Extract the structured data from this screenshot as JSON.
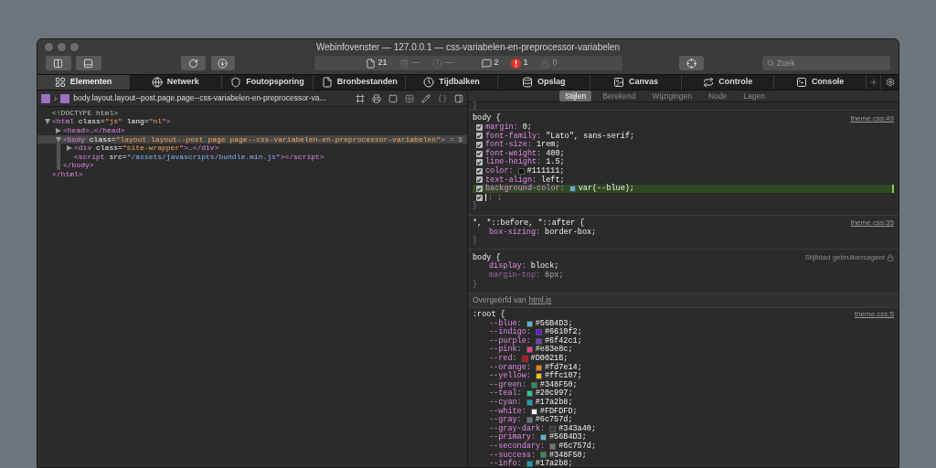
{
  "window": {
    "title": "Webinfovenster — 127.0.0.1 — css-variabelen-en-preprocessor-variabelen"
  },
  "toolbar": {
    "status_items": [
      {
        "text": "21",
        "disabled": false
      },
      {
        "text": "—",
        "disabled": true
      },
      {
        "text": "—",
        "disabled": true
      },
      {
        "text": "2",
        "disabled": false
      },
      {
        "text": "1",
        "disabled": false
      },
      {
        "text": "0",
        "disabled": true
      }
    ],
    "search": {
      "placeholder": "Zoek"
    }
  },
  "tabs": [
    {
      "label": "Elementen",
      "selected": true
    },
    {
      "label": "Netwerk",
      "selected": false
    },
    {
      "label": "Foutopsporing",
      "selected": false
    },
    {
      "label": "Bronbestanden",
      "selected": false
    },
    {
      "label": "Tijdbalken",
      "selected": false
    },
    {
      "label": "Opslag",
      "selected": false
    },
    {
      "label": "Canvas",
      "selected": false
    },
    {
      "label": "Controle",
      "selected": false
    },
    {
      "label": "Console",
      "selected": false
    }
  ],
  "breadcrumb": {
    "separator": "›",
    "path": "body.layout.layout--post.page.page--css-variabelen-en-preprocessor-va..."
  },
  "dom_tree": [
    {
      "kind": "doctype",
      "text": "<!DOCTYPE html>"
    },
    {
      "kind": "element",
      "expanded": true,
      "selected": false,
      "parts": [
        {
          "kind": "tag",
          "text": "<html"
        },
        {
          "kind": "attr",
          "text": " class="
        },
        {
          "kind": "value",
          "text": "\"js\""
        },
        {
          "kind": "attr",
          "text": " lang="
        },
        {
          "kind": "value",
          "text": "\"nl\""
        },
        {
          "kind": "tag",
          "text": ">"
        }
      ],
      "closing": "</html>",
      "children": [
        {
          "kind": "element",
          "expanded": false,
          "selected": false,
          "parts": [
            {
              "kind": "tag",
              "text": "<head>"
            },
            {
              "kind": "text",
              "text": "…"
            },
            {
              "kind": "tag",
              "text": "</head>"
            }
          ]
        },
        {
          "kind": "element",
          "expanded": true,
          "selected": true,
          "suffix": "= $",
          "parts": [
            {
              "kind": "tag",
              "text": "<body"
            },
            {
              "kind": "attr",
              "text": " class="
            },
            {
              "kind": "value",
              "text": "\"layout layout--post page page--css-variabelen-en-preprocessor-variabelen\""
            },
            {
              "kind": "tag",
              "text": ">"
            }
          ],
          "closing": "</body>",
          "children": [
            {
              "kind": "element",
              "expanded": false,
              "selected": false,
              "parts": [
                {
                  "kind": "tag",
                  "text": "<div"
                },
                {
                  "kind": "attr",
                  "text": " class="
                },
                {
                  "kind": "value",
                  "text": "\"site-wrapper\""
                },
                {
                  "kind": "tag",
                  "text": ">"
                },
                {
                  "kind": "text",
                  "text": "…"
                },
                {
                  "kind": "tag",
                  "text": "</div>"
                }
              ]
            },
            {
              "kind": "element",
              "selected": false,
              "parts": [
                {
                  "kind": "tag",
                  "text": "<script"
                },
                {
                  "kind": "attr",
                  "text": " src="
                },
                {
                  "kind": "link",
                  "text": "\"/assets/javascripts/bundle.min.js\""
                },
                {
                  "kind": "tag",
                  "text": "></script>"
                }
              ]
            }
          ]
        }
      ]
    }
  ],
  "styles": {
    "subtabs": [
      {
        "label": "Stijlen",
        "selected": true
      },
      {
        "label": "Berekend",
        "selected": false
      },
      {
        "label": "Wijzigingen",
        "selected": false
      },
      {
        "label": "Node",
        "selected": false
      },
      {
        "label": "Lagen",
        "selected": false
      }
    ],
    "previous_rule_end": "}",
    "rules": [
      {
        "selector": "body {",
        "source": "theme.css:49",
        "close": "}",
        "declarations": [
          {
            "property": "margin:",
            "value": "0;",
            "checked": true
          },
          {
            "property": "font-family:",
            "value": "\"Lato\", sans-serif;",
            "checked": true
          },
          {
            "property": "font-size:",
            "value": "1rem;",
            "checked": true
          },
          {
            "property": "font-weight:",
            "value": "400;",
            "checked": true
          },
          {
            "property": "line-height:",
            "value": "1.5;",
            "checked": true
          },
          {
            "property": "color:",
            "value": "#111111;",
            "checked": true,
            "color": "#111111"
          },
          {
            "property": "text-align:",
            "value": "left;",
            "checked": true
          },
          {
            "property": "background-color:",
            "value": "var(--blue);",
            "checked": true,
            "highlighted": true,
            "color": "#56b4d3"
          },
          {
            "placeholder": ": ;",
            "checked": true,
            "editing": true
          }
        ]
      },
      {
        "selector": "*, *::before, *::after {",
        "source": "theme.css:35",
        "close": "}",
        "declarations": [
          {
            "property": "box-sizing:",
            "value": "border-box;"
          }
        ]
      },
      {
        "selector": "body {",
        "source_label": "Stijlblad gebruikersagent",
        "close": "}",
        "declarations": [
          {
            "property": "display:",
            "value": "block;"
          },
          {
            "property": "margin-top:",
            "value": "8px;",
            "overridden": true
          }
        ]
      }
    ],
    "inherited": {
      "label": "Overgeërfd van",
      "link": "html.js"
    },
    "root_rule": {
      "selector": ":root {",
      "source": "theme.css:5",
      "declarations": [
        {
          "property": "--blue:",
          "value": "#56B4D3;",
          "color": "#56b4d3"
        },
        {
          "property": "--indigo:",
          "value": "#6610f2;",
          "color": "#6610f2"
        },
        {
          "property": "--purple:",
          "value": "#6f42c1;",
          "color": "#6f42c1"
        },
        {
          "property": "--pink:",
          "value": "#e83e8c;",
          "color": "#e83e8c"
        },
        {
          "property": "--red:",
          "value": "#D0021B;",
          "color": "#d0021b"
        },
        {
          "property": "--orange:",
          "value": "#fd7e14;",
          "color": "#fd7e14"
        },
        {
          "property": "--yellow:",
          "value": "#ffc107;",
          "color": "#ffc107"
        },
        {
          "property": "--green:",
          "value": "#348F50;",
          "color": "#348f50"
        },
        {
          "property": "--teal:",
          "value": "#20c997;",
          "color": "#20c997"
        },
        {
          "property": "--cyan:",
          "value": "#17a2b8;",
          "color": "#17a2b8"
        },
        {
          "property": "--white:",
          "value": "#FDFDFD;",
          "color": "#fdfdfd"
        },
        {
          "property": "--gray:",
          "value": "#6c757d;",
          "color": "#6c757d"
        },
        {
          "property": "--gray-dark:",
          "value": "#343a40;",
          "color": "#343a40"
        },
        {
          "property": "--primary:",
          "value": "#56B4D3;",
          "color": "#56b4d3"
        },
        {
          "property": "--secondary:",
          "value": "#6c757d;",
          "color": "#6c757d"
        },
        {
          "property": "--success:",
          "value": "#348F50;",
          "color": "#348f50"
        },
        {
          "property": "--info:",
          "value": "#17a2b8;",
          "color": "#17a2b8"
        }
      ]
    }
  }
}
